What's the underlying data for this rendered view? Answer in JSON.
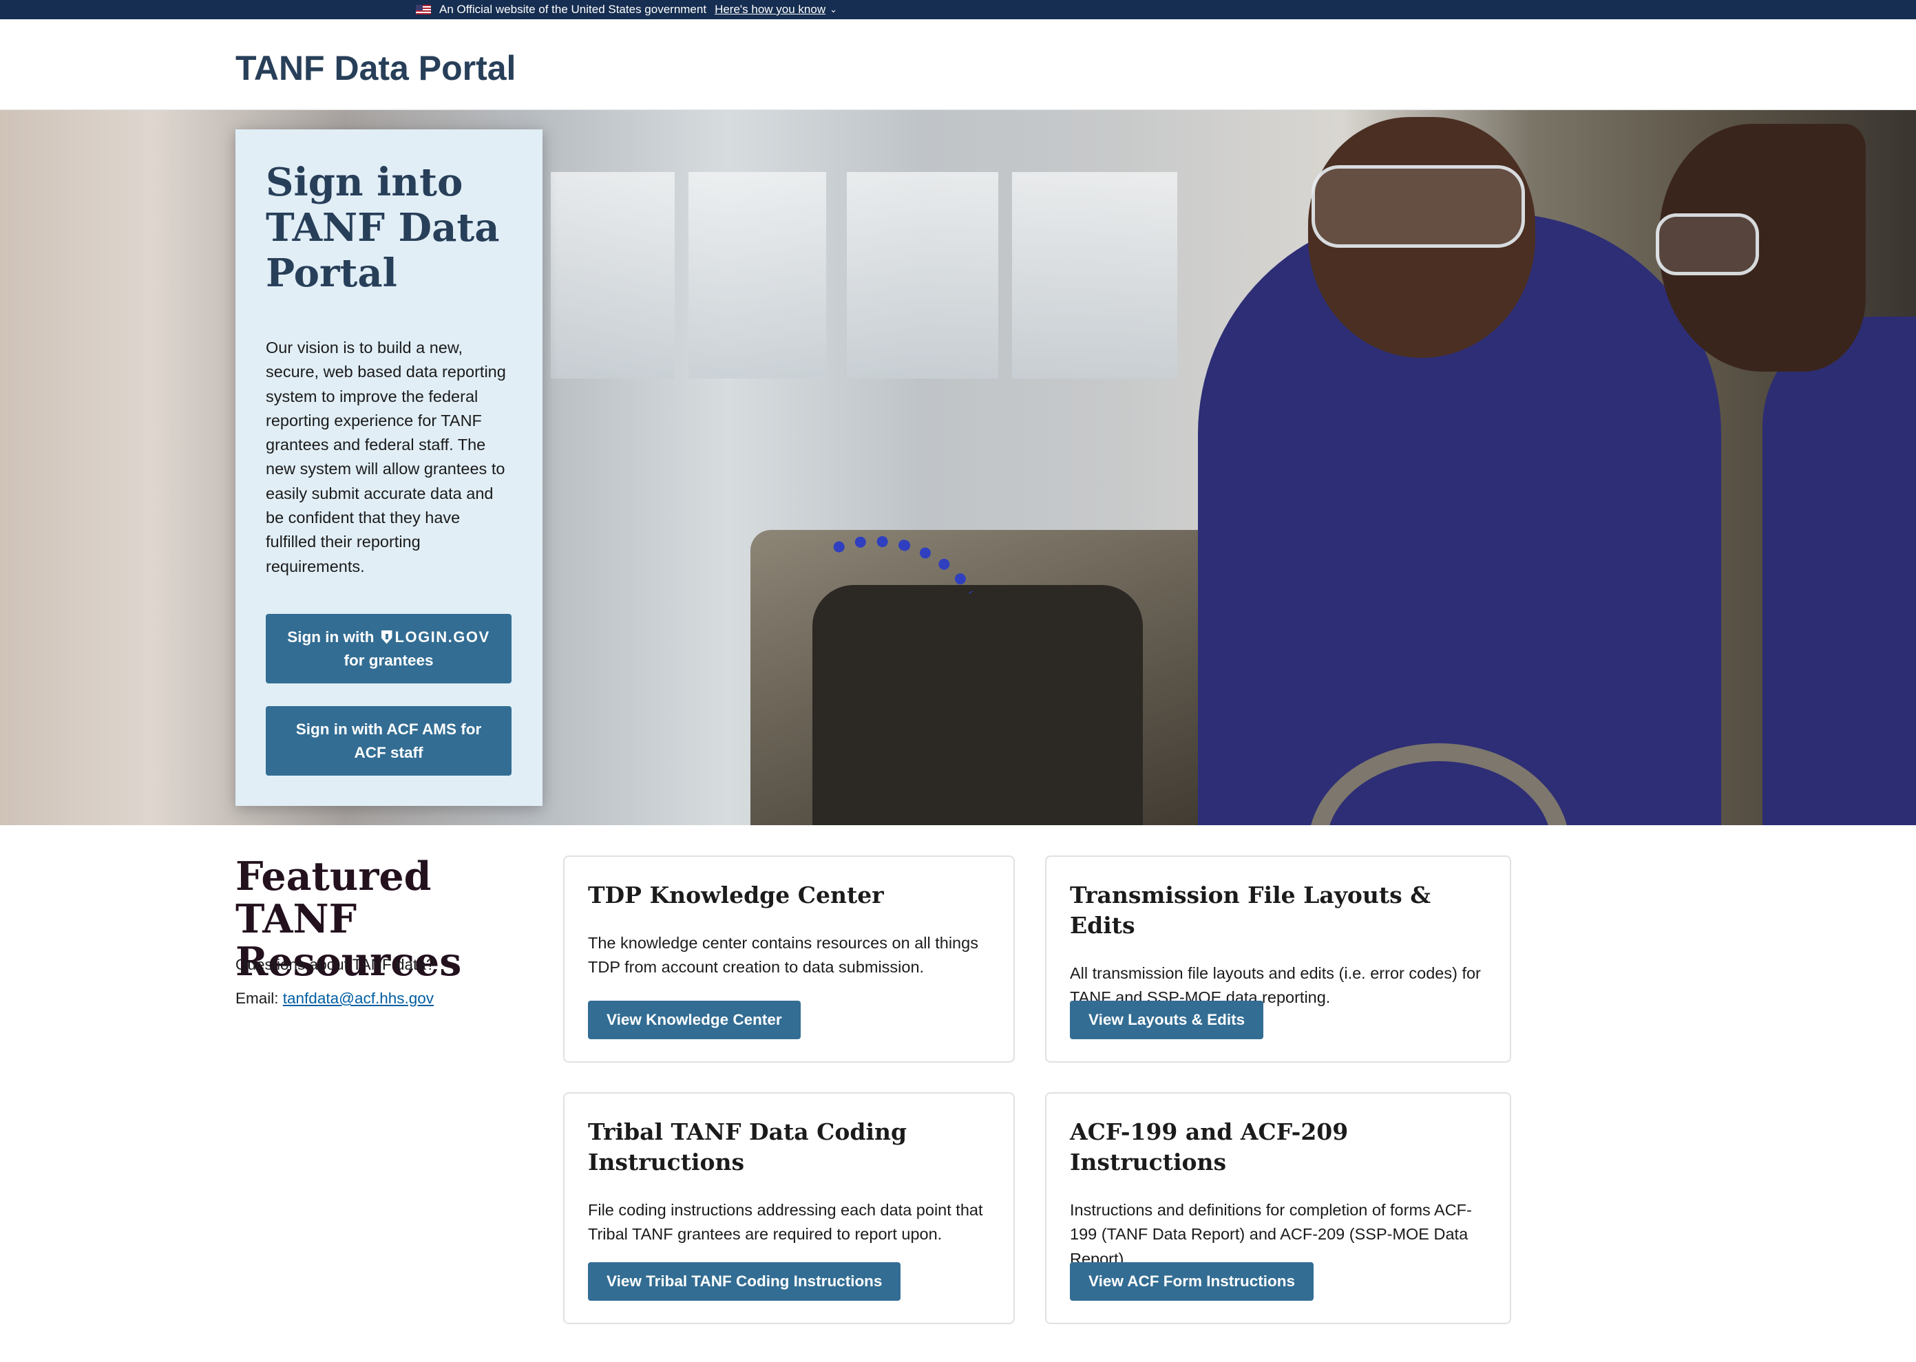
{
  "gov_banner": {
    "text": "An Official website of the United States government",
    "link": "Here's how you know"
  },
  "header": {
    "title": "TANF Data Portal"
  },
  "signin": {
    "title": "Sign into TANF Data Portal",
    "description": "Our vision is to build a new, secure, web based data reporting system to improve the federal reporting experience for TANF grantees and federal staff. The new system will allow grantees to easily submit accurate data and be confident that they have fulfilled their reporting requirements.",
    "logingov_button": {
      "prefix": "Sign in with",
      "brand": "LOGIN.GOV",
      "suffix": "for grantees"
    },
    "ams_button": "Sign in with ACF AMS for ACF staff"
  },
  "featured": {
    "title": "Featured TANF Resources",
    "question": "Questions about TANF data?",
    "email_label": "Email:",
    "email": "tanfdata@acf.hhs.gov"
  },
  "cards": [
    {
      "title": "TDP Knowledge Center",
      "text": "The knowledge center contains resources on all things TDP from account creation to data submission.",
      "button": "View Knowledge Center"
    },
    {
      "title": "Transmission File Layouts & Edits",
      "text": "All transmission file layouts and edits (i.e. error codes) for TANF and SSP-MOE data reporting.",
      "button": "View Layouts & Edits"
    },
    {
      "title": "Tribal TANF Data Coding Instructions",
      "text": "File coding instructions addressing each data point that Tribal TANF grantees are required to report upon.",
      "button": "View Tribal TANF Coding Instructions"
    },
    {
      "title": "ACF-199 and ACF-209 Instructions",
      "text": "Instructions and definitions for completion of forms ACF-199 (TANF Data Report) and ACF-209 (SSP-MOE Data Report).",
      "button": "View ACF Form Instructions"
    }
  ],
  "colors": {
    "banner": "#162e51",
    "title": "#283f59",
    "button": "#336d93",
    "signin_card": "#e1eef6",
    "link": "#005ea2"
  },
  "icons": [
    "us-flag-icon",
    "chevron-down-icon",
    "login-gov-shield-icon"
  ]
}
